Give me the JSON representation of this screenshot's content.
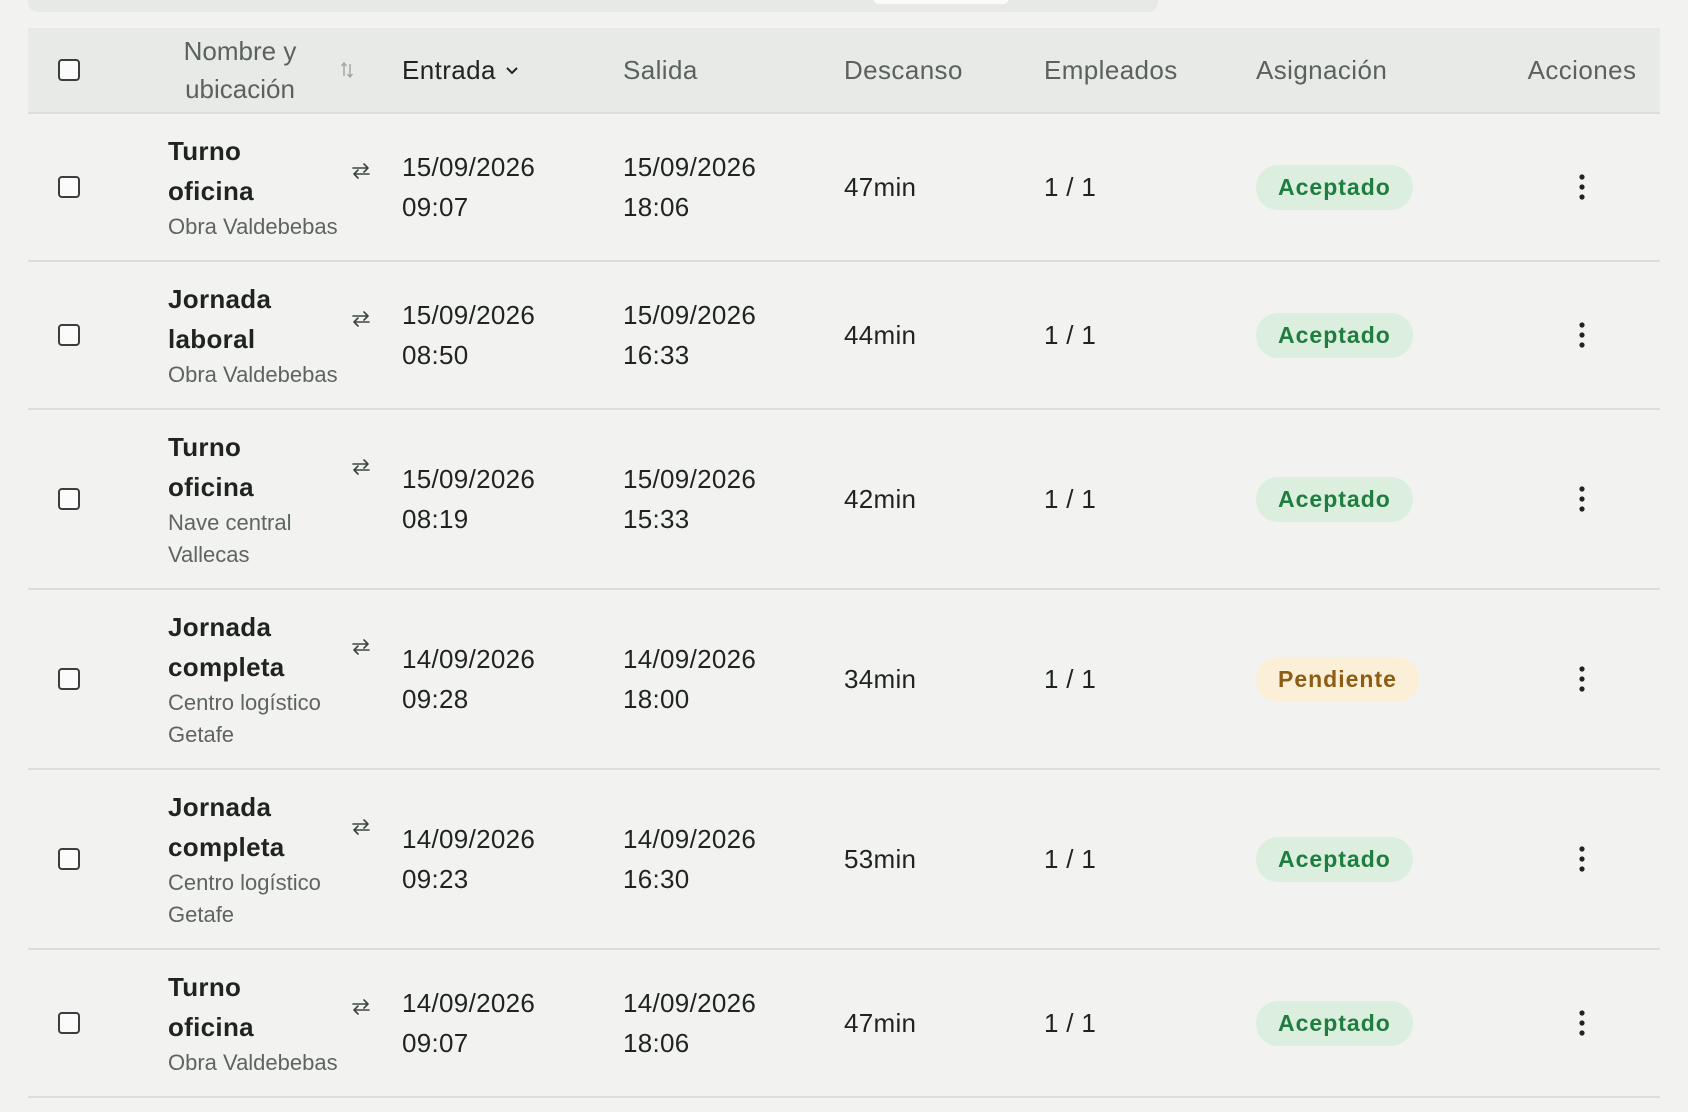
{
  "table": {
    "headers": {
      "name": "Nombre y ubicación",
      "entry": "Entrada",
      "exit": "Salida",
      "break": "Descanso",
      "employees": "Empleados",
      "assignment": "Asignación",
      "actions": "Acciones"
    },
    "rows": [
      {
        "name_line1": "Turno",
        "name_line2": "oficina",
        "location_line1": "Obra Valdebebas",
        "location_line2": "",
        "entry_date": "15/09/2026",
        "entry_time": "09:07",
        "exit_date": "15/09/2026",
        "exit_time": "18:06",
        "break": "47min",
        "employees": "1 / 1",
        "status": "Aceptado",
        "status_kind": "ok"
      },
      {
        "name_line1": "Jornada",
        "name_line2": "laboral",
        "location_line1": "Obra Valdebebas",
        "location_line2": "",
        "entry_date": "15/09/2026",
        "entry_time": "08:50",
        "exit_date": "15/09/2026",
        "exit_time": "16:33",
        "break": "44min",
        "employees": "1 / 1",
        "status": "Aceptado",
        "status_kind": "ok"
      },
      {
        "name_line1": "Turno",
        "name_line2": "oficina",
        "location_line1": "Nave central",
        "location_line2": "Vallecas",
        "entry_date": "15/09/2026",
        "entry_time": "08:19",
        "exit_date": "15/09/2026",
        "exit_time": "15:33",
        "break": "42min",
        "employees": "1 / 1",
        "status": "Aceptado",
        "status_kind": "ok"
      },
      {
        "name_line1": "Jornada",
        "name_line2": "completa",
        "location_line1": "Centro logístico",
        "location_line2": "Getafe",
        "entry_date": "14/09/2026",
        "entry_time": "09:28",
        "exit_date": "14/09/2026",
        "exit_time": "18:00",
        "break": "34min",
        "employees": "1 / 1",
        "status": "Pendiente",
        "status_kind": "pending"
      },
      {
        "name_line1": "Jornada",
        "name_line2": "completa",
        "location_line1": "Centro logístico",
        "location_line2": "Getafe",
        "entry_date": "14/09/2026",
        "entry_time": "09:23",
        "exit_date": "14/09/2026",
        "exit_time": "16:30",
        "break": "53min",
        "employees": "1 / 1",
        "status": "Aceptado",
        "status_kind": "ok"
      },
      {
        "name_line1": "Turno",
        "name_line2": "oficina",
        "location_line1": "Obra Valdebebas",
        "location_line2": "",
        "entry_date": "14/09/2026",
        "entry_time": "09:07",
        "exit_date": "14/09/2026",
        "exit_time": "18:06",
        "break": "47min",
        "employees": "1 / 1",
        "status": "Aceptado",
        "status_kind": "ok"
      }
    ]
  },
  "colors": {
    "accepted_bg": "#dcefdf",
    "accepted_text": "#1e7d3f",
    "pending_bg": "#fbefd8",
    "pending_text": "#8c5d13"
  },
  "icons": {
    "sort": "sort-icon",
    "chevron": "chevron-down-icon",
    "swap": "swap-arrows-icon",
    "menu": "more-vertical-icon"
  }
}
